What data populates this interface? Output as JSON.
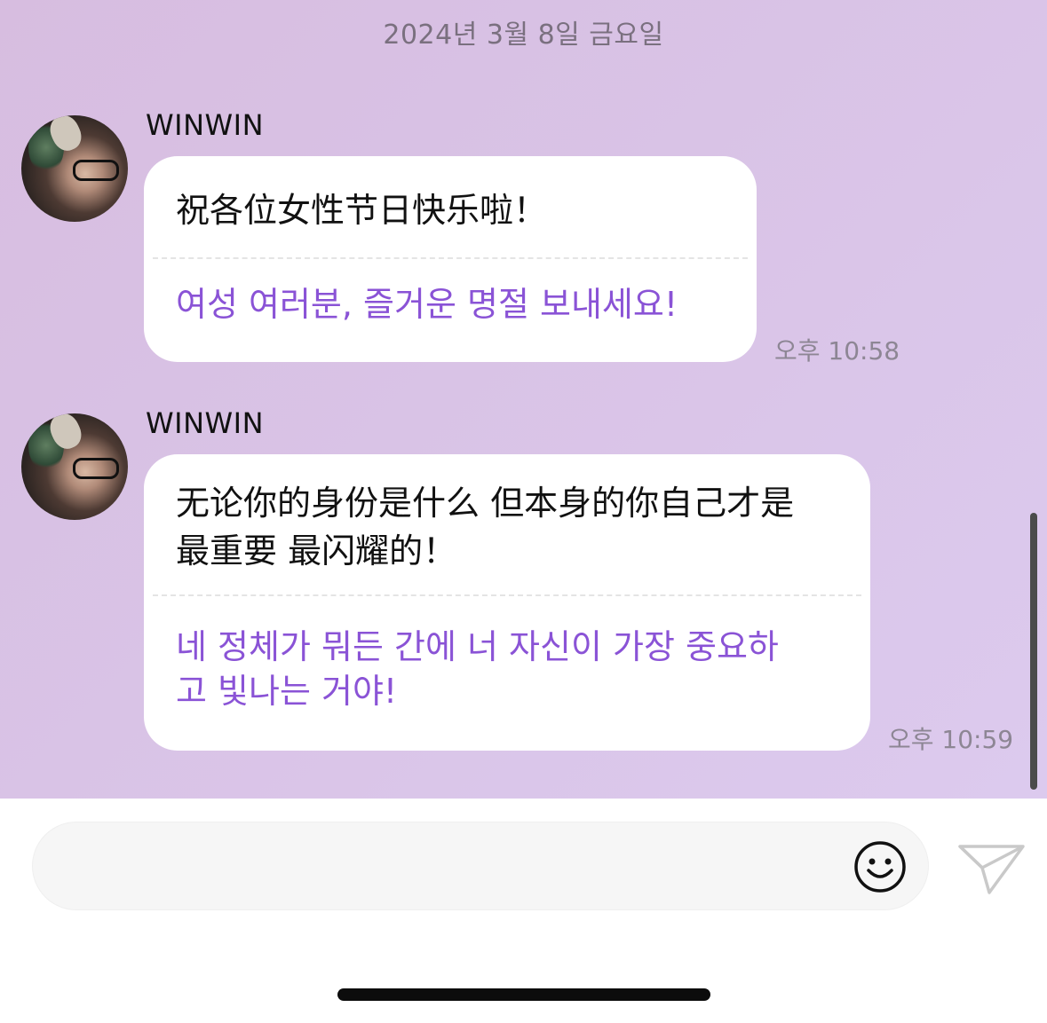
{
  "date_divider": "2024년 3월 8일 금요일",
  "messages": [
    {
      "sender": "WINWIN",
      "original": "祝各位女性节日快乐啦！",
      "translation": "여성 여러분, 즐거운 명절 보내세요!",
      "time": "오후 10:58"
    },
    {
      "sender": "WINWIN",
      "original_line1": "无论你的身份是什么 但本身的你自己才是",
      "original_line2": "最重要 最闪耀的！",
      "translation_line1": "네 정체가 뭐든 간에 너 자신이 가장 중요하",
      "translation_line2": "고 빛나는 거야!",
      "time": "오후 10:59"
    }
  ],
  "input": {
    "placeholder": ""
  },
  "icons": {
    "emoji": "smiley-face-icon",
    "send": "paper-plane-icon"
  },
  "colors": {
    "background": "#d9c3e6",
    "translation_text": "#8a53d6",
    "bubble": "#ffffff"
  }
}
